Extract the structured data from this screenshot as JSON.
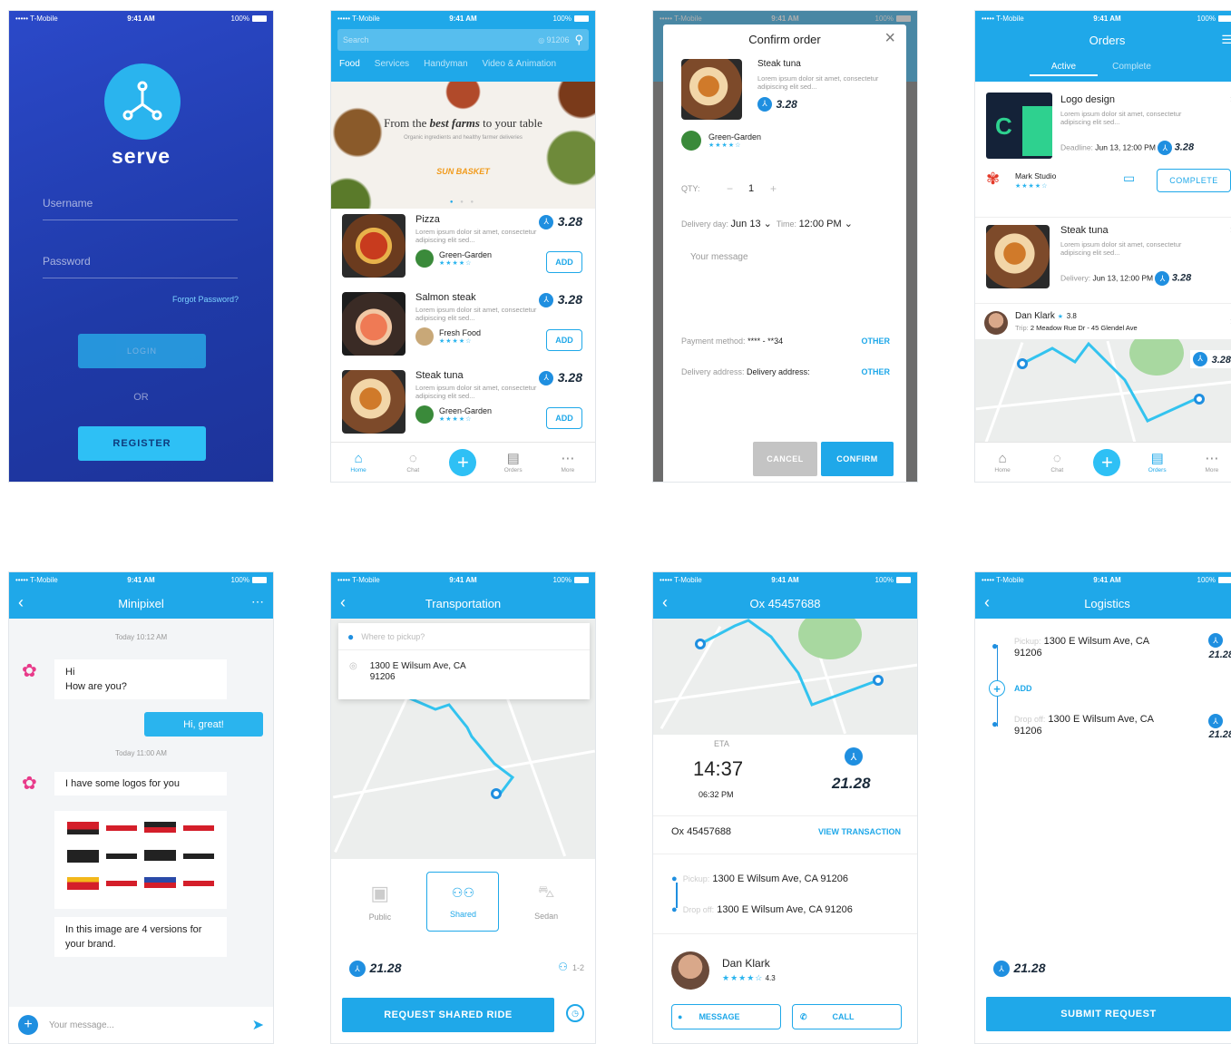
{
  "status": {
    "carrier": "••••• T-Mobile",
    "time": "9:41 AM",
    "battery": "100%"
  },
  "login": {
    "app_name": "serve",
    "username": "Username",
    "password": "Password",
    "forgot": "Forgot Password?",
    "login": "LOGIN",
    "or": "OR",
    "register": "REGISTER"
  },
  "browse": {
    "search_placeholder": "Search",
    "search_zip": "91206",
    "categories": [
      "Food",
      "Services",
      "Handyman",
      "Video & Animation"
    ],
    "banner_title_pre": "From the",
    "banner_title_em": "best farms",
    "banner_title_post": "to your table",
    "banner_sub": "Organic ingredients and healthy farmer deliveries",
    "banner_brand": "SUN BASKET",
    "items": [
      {
        "name": "Pizza",
        "desc": "Lorem ipsum dolor sit amet, consectetur adipiscing elit sed...",
        "price": "3.28",
        "vendor": "Green-Garden",
        "add": "ADD"
      },
      {
        "name": "Salmon steak",
        "desc": "Lorem ipsum dolor sit amet, consectetur adipiscing elit sed...",
        "price": "3.28",
        "vendor": "Fresh Food",
        "add": "ADD"
      },
      {
        "name": "Steak tuna",
        "desc": "Lorem ipsum dolor sit amet, consectetur adipiscing elit sed...",
        "price": "3.28",
        "vendor": "Green-Garden",
        "add": "ADD"
      }
    ],
    "tabs": [
      "Home",
      "Chat",
      "Orders",
      "More"
    ]
  },
  "confirm": {
    "title": "Confirm order",
    "item": "Steak tuna",
    "desc": "Lorem ipsum dolor sit amet, consectetur adipiscing elit sed...",
    "price": "3.28",
    "vendor": "Green-Garden",
    "qty_label": "QTY:",
    "qty": "1",
    "minus": "−",
    "plus": "+",
    "day_label": "Delivery day:",
    "day": "Jun 13",
    "time_label": "Time:",
    "time": "12:00 PM",
    "message_placeholder": "Your message",
    "payment_label": "Payment method:",
    "payment_value": "**** - **34",
    "other": "OTHER",
    "address_label": "Delivery address:",
    "address_value": "Delivery address:",
    "cancel": "CANCEL",
    "confirm": "CONFIRM"
  },
  "orders": {
    "title": "Orders",
    "tab_active": "Active",
    "tab_complete": "Complete",
    "o1_title": "Logo design",
    "o1_desc": "Lorem ipsum dolor sit amet, consectetur adipiscing elit sed...",
    "o1_deadline_label": "Deadline:",
    "o1_deadline": "Jun 13, 12:00 PM",
    "o1_price": "3.28",
    "studio": "Mark Studio",
    "complete_btn": "COMPLETE",
    "o2_title": "Steak tuna",
    "o2_desc": "Lorem ipsum dolor sit amet, consectetur adipiscing elit sed...",
    "o2_delivery_label": "Delivery:",
    "o2_delivery": "Jun 13, 12:00 PM",
    "o2_price": "3.28",
    "driver": "Dan Klark",
    "driver_rating": "3.8",
    "trip_label": "Trip:",
    "trip": "2 Meadow Rue Dr - 45 Glendel Ave",
    "map_price": "3.28",
    "tabs": [
      "Home",
      "Chat",
      "Orders",
      "More"
    ]
  },
  "chat": {
    "title": "Minipixel",
    "t1": "Today 10:12 AM",
    "m1a": "Hi",
    "m1b": "How are you?",
    "reply": "Hi, great!",
    "t2": "Today 11:00 AM",
    "m2": "I have some logos for you",
    "m3": "In this image are 4 versions for your brand.",
    "input_placeholder": "Your message..."
  },
  "transport": {
    "title": "Transportation",
    "pickup_placeholder": "Where to pickup?",
    "address": "1300 E Wilsum Ave, CA 91206",
    "options": [
      "Public",
      "Shared",
      "Sedan"
    ],
    "price": "21.28",
    "seats": "1-2",
    "request": "REQUEST SHARED RIDE"
  },
  "tracking": {
    "title": "Ox 45457688",
    "eta_label": "ETA",
    "eta": "14:37",
    "eta_time": "06:32 PM",
    "price": "21.28",
    "tx_id": "Ox 45457688",
    "view_tx": "VIEW TRANSACTION",
    "pickup_label": "Pickup:",
    "pickup": "1300 E Wilsum Ave, CA 91206",
    "dropoff_label": "Drop off:",
    "dropoff": "1300 E Wilsum Ave, CA 91206",
    "driver": "Dan Klark",
    "rating": "4.3",
    "message": "MESSAGE",
    "call": "CALL"
  },
  "logistics": {
    "title": "Logistics",
    "pickup_label": "Pickup:",
    "pickup": "1300 E Wilsum Ave, CA 91206",
    "add": "ADD",
    "dropoff_label": "Drop off:",
    "dropoff": "1300 E Wilsum Ave, CA 91206",
    "leg_price": "21.28",
    "total": "21.28",
    "submit": "SUBMIT REQUEST"
  }
}
